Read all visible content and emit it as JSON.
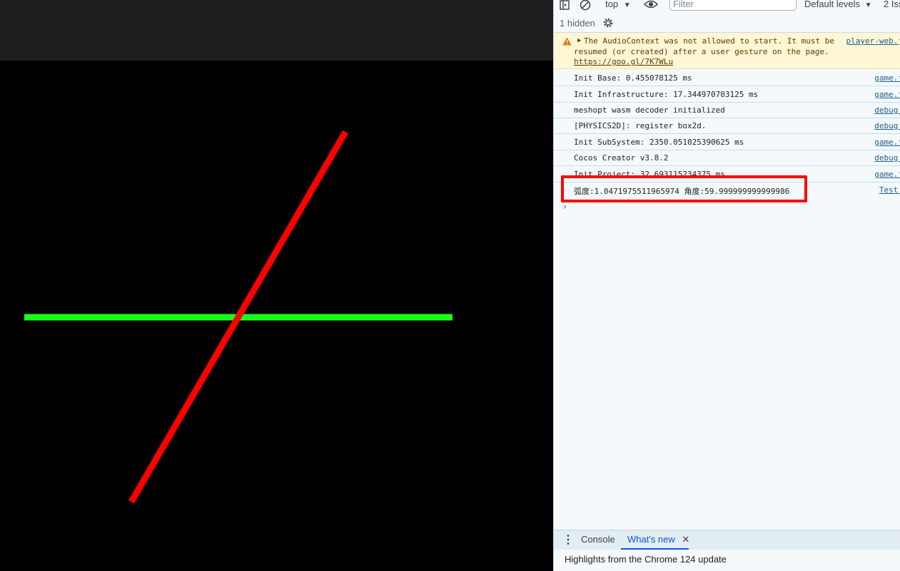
{
  "devtools": {
    "toolbar": {
      "context": "top",
      "filter_placeholder": "Filter",
      "levels": "Default levels",
      "issues": "2 Iss"
    },
    "hidden": "1 hidden",
    "warning": {
      "line1": "The AudioContext was not allowed to start. It must be",
      "line2": "resumed (or created) after a user gesture on the page.",
      "link": "https://goo.gl/7K7WLu",
      "source": "player-web.j"
    },
    "logs": [
      {
        "text": "Init Base: 0.455078125 ms",
        "source": "game.f"
      },
      {
        "text": "Init Infrastructure: 17.344970703125 ms",
        "source": "game.f"
      },
      {
        "text": "meshopt wasm decoder initialized",
        "source": "debug."
      },
      {
        "text": "[PHYSICS2D]: register box2d.",
        "source": "debug."
      },
      {
        "text": "Init SubSystem: 2350.051025390625 ms",
        "source": "game.f"
      },
      {
        "text": "Cocos Creator v3.8.2",
        "source": "debug."
      },
      {
        "text": "Init Project: 32.693115234375 ms",
        "source": "game.f"
      },
      {
        "text": "弧度:1.0471975511965974 角度:59.999999999999986",
        "source": "Test."
      }
    ],
    "prompt": "›",
    "drawer": {
      "tab_console": "Console",
      "tab_whats_new": "What's new",
      "content": "Highlights from the Chrome 124 update"
    }
  },
  "colors": {
    "green_line": "#19ff19",
    "red_line": "#ff0000",
    "highlight": "#ff0000"
  }
}
